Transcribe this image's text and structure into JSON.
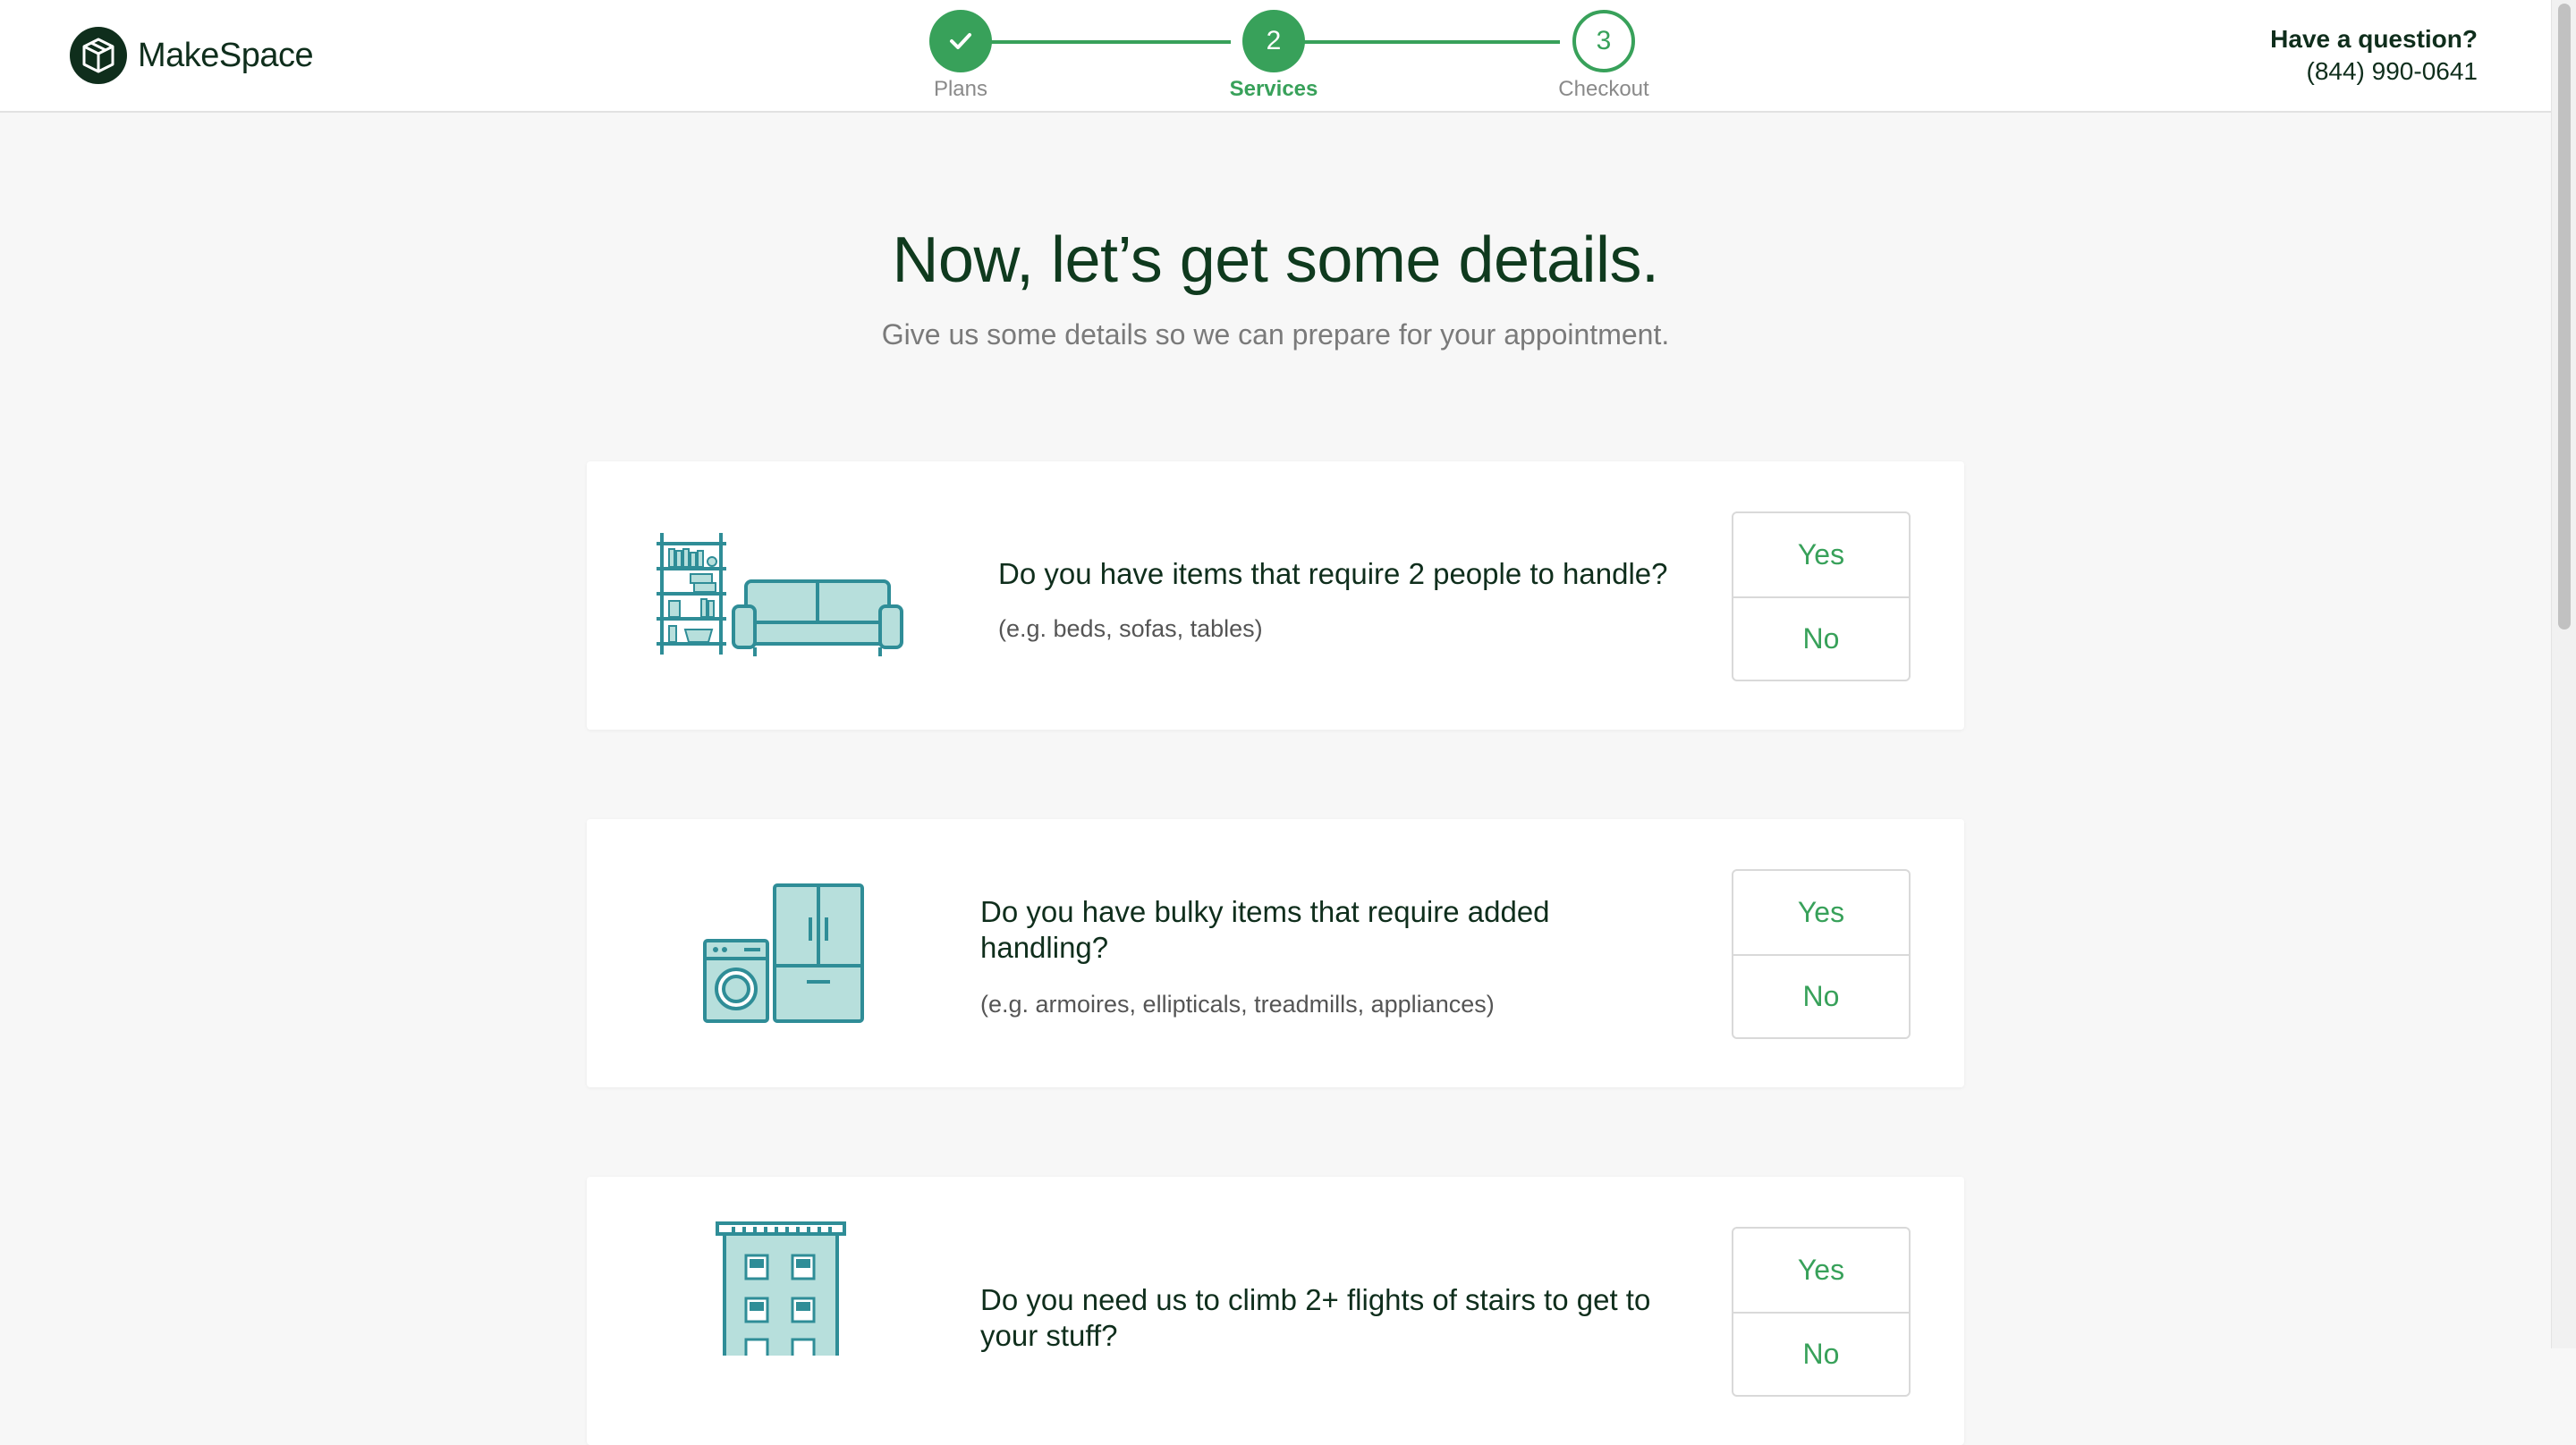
{
  "brand": {
    "name": "MakeSpace",
    "accent": "#38a15a",
    "dark": "#0f2e1c"
  },
  "stepper": {
    "steps": [
      {
        "number": "1",
        "label": "Plans",
        "state": "done",
        "icon": "check-icon"
      },
      {
        "number": "2",
        "label": "Services",
        "state": "active"
      },
      {
        "number": "3",
        "label": "Checkout",
        "state": "todo"
      }
    ]
  },
  "help": {
    "title": "Have a question?",
    "phone": "(844) 990-0641"
  },
  "hero": {
    "title": "Now, let’s get some details.",
    "subtitle": "Give us some details so we can prepare for your appointment."
  },
  "questions": [
    {
      "icon": "furniture-icon",
      "question": "Do you have items that require 2 people to handle?",
      "example": "(e.g. beds, sofas, tables)",
      "yes_label": "Yes",
      "no_label": "No"
    },
    {
      "icon": "appliances-icon",
      "question": "Do you have bulky items that require added handling?",
      "example": "(e.g. armoires, ellipticals, treadmills, appliances)",
      "yes_label": "Yes",
      "no_label": "No"
    },
    {
      "icon": "building-icon",
      "question": "Do you need us to climb 2+ flights of stairs to get to your stuff?",
      "example": "",
      "yes_label": "Yes",
      "no_label": "No"
    }
  ]
}
